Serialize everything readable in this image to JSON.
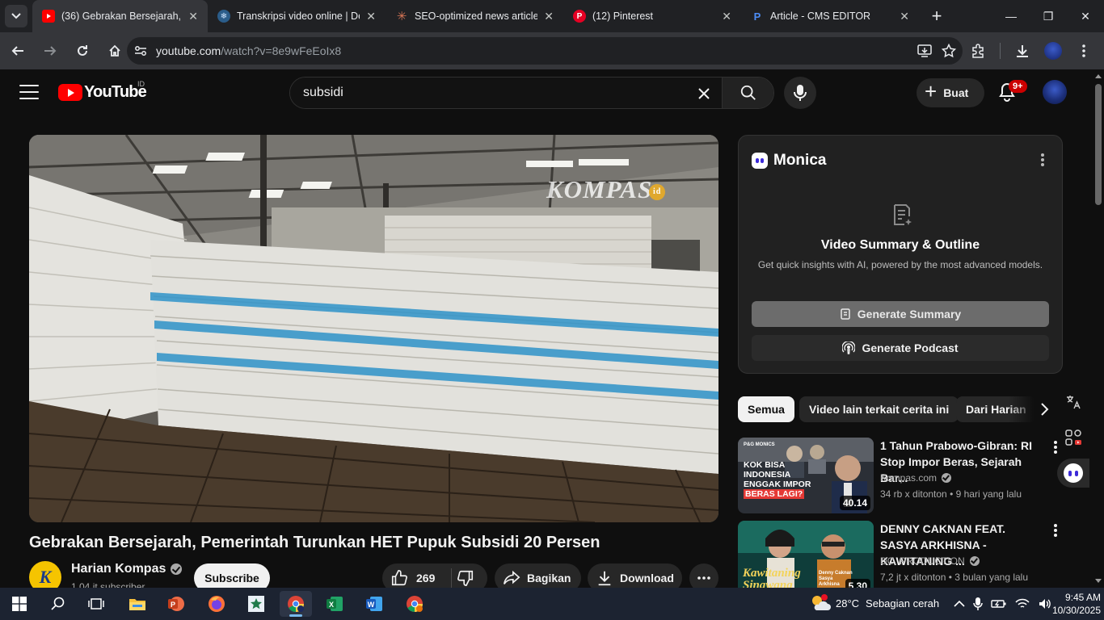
{
  "browser": {
    "tabs": [
      {
        "title": "(36) Gebrakan Bersejarah, Pe",
        "favicon": "youtube-icon",
        "active": true
      },
      {
        "title": "Transkripsi video online | Des",
        "favicon": "transcription-icon",
        "active": false
      },
      {
        "title": "SEO-optimized news article",
        "favicon": "claude-icon",
        "active": false
      },
      {
        "title": "(12) Pinterest",
        "favicon": "pinterest-icon",
        "active": false
      },
      {
        "title": "Article - CMS EDITOR",
        "favicon": "cms-icon",
        "active": false
      }
    ],
    "url_host": "youtube.com",
    "url_path": "/watch?v=8e9wFeEoIx8"
  },
  "youtube": {
    "logo_text": "YouTube",
    "country_code": "ID",
    "search_query": "subsidi",
    "create_label": "Buat",
    "notification_count": "9+"
  },
  "video": {
    "watermark": "KOMPAS",
    "watermark_suffix": "id",
    "title": "Gebrakan Bersejarah, Pemerintah Turunkan HET Pupuk Subsidi 20 Persen",
    "channel": {
      "name": "Harian Kompas",
      "subscribers": "1,04 jt subscriber",
      "avatar_letter": "K"
    },
    "subscribe_label": "Subscribe",
    "likes": "269",
    "share_label": "Bagikan",
    "download_label": "Download"
  },
  "monica": {
    "name": "Monica",
    "panel_title": "Video Summary & Outline",
    "panel_subtitle": "Get quick insights with AI, powered by the most advanced models.",
    "generate_summary": "Generate Summary",
    "generate_podcast": "Generate Podcast"
  },
  "chips": [
    "Semua",
    "Video lain terkait cerita ini",
    "Dari Harian"
  ],
  "related": [
    {
      "title": "1 Tahun Prabowo-Gibran: RI Stop Impor Beras, Sejarah Bar...",
      "channel": "Kompas.com",
      "views": "34 rb x ditonton",
      "age": "9 hari yang lalu",
      "duration": "40.14",
      "thumb_lines": [
        "KOK BISA",
        "INDONESIA",
        "ENGGAK IMPOR",
        "BERAS LAGI?"
      ],
      "thumb_tag": "P&G MONICS"
    },
    {
      "title": "DENNY CAKNAN FEAT. SASYA ARKHISNA - KAWITANING ...",
      "channel": "DC. PRODUCTION",
      "views": "7,2 jt x ditonton",
      "age": "3 bulan yang lalu",
      "duration": "5.30",
      "thumb_lines": [
        "Kawitaning",
        "Sinawang"
      ],
      "thumb_tag": "Denny Caknan Sasya Arkhisna"
    }
  ],
  "taskbar": {
    "temperature": "28°C",
    "weather_text": "Sebagian cerah",
    "time": "9:45 AM",
    "date": "10/30/2025"
  },
  "colors": {
    "youtube_red": "#ff0000",
    "background": "#0f0f0f",
    "chrome_dark": "#202124",
    "taskbar": "#1c2331"
  }
}
